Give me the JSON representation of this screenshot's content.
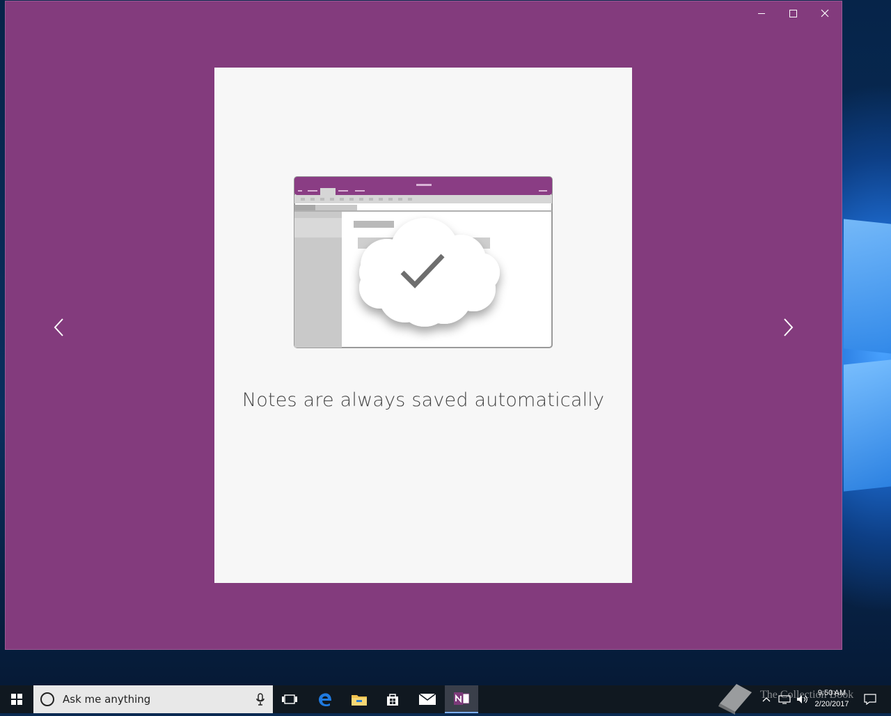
{
  "window": {
    "controls": {
      "minimize": "minimize-icon",
      "maximize": "maximize-icon",
      "close": "close-icon"
    },
    "accent": "#833b7d"
  },
  "onboarding": {
    "caption": "Notes are always saved automatically",
    "prev_icon": "chevron-left-icon",
    "next_icon": "chevron-right-icon"
  },
  "taskbar": {
    "search_placeholder": "Ask me anything",
    "apps": [
      "task-view-icon",
      "edge-icon",
      "file-explorer-icon",
      "store-icon",
      "mail-icon",
      "onenote-icon"
    ],
    "clock": {
      "time": "9:50 AM",
      "date": "2/20/2017"
    },
    "watermark": "The Collection Book"
  }
}
